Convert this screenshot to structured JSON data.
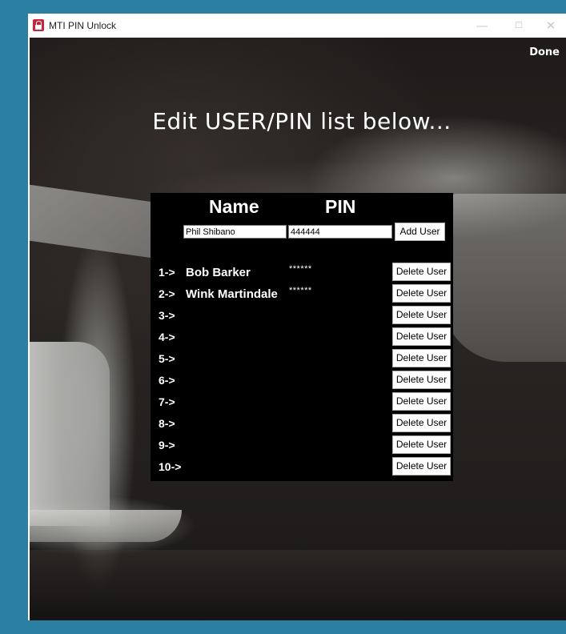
{
  "window": {
    "title": "MTI PIN Unlock",
    "controls": {
      "minimize": "—",
      "maximize": "☐",
      "close": "✕"
    }
  },
  "toolbar": {
    "done_label": "Done"
  },
  "heading": "Edit USER/PIN list below...",
  "columns": {
    "name": "Name",
    "pin": "PIN"
  },
  "new_user": {
    "name_value": "Phil Shibano",
    "pin_value": "444444",
    "add_label": "Add User"
  },
  "users": [
    {
      "num": "1->",
      "name": "Bob Barker",
      "pin": "******",
      "delete_label": "Delete User"
    },
    {
      "num": "2->",
      "name": "Wink Martindale",
      "pin": "******",
      "delete_label": "Delete User"
    },
    {
      "num": "3->",
      "name": "",
      "pin": "",
      "delete_label": "Delete User"
    },
    {
      "num": "4->",
      "name": "",
      "pin": "",
      "delete_label": "Delete User"
    },
    {
      "num": "5->",
      "name": "",
      "pin": "",
      "delete_label": "Delete User"
    },
    {
      "num": "6->",
      "name": "",
      "pin": "",
      "delete_label": "Delete User"
    },
    {
      "num": "7->",
      "name": "",
      "pin": "",
      "delete_label": "Delete User"
    },
    {
      "num": "8->",
      "name": "",
      "pin": "",
      "delete_label": "Delete User"
    },
    {
      "num": "9->",
      "name": "",
      "pin": "",
      "delete_label": "Delete User"
    },
    {
      "num": "10->",
      "name": "",
      "pin": "",
      "delete_label": "Delete User"
    }
  ],
  "colors": {
    "desktop": "#2b7fa3",
    "panel": "#000000",
    "app_icon": "#c8243a"
  }
}
